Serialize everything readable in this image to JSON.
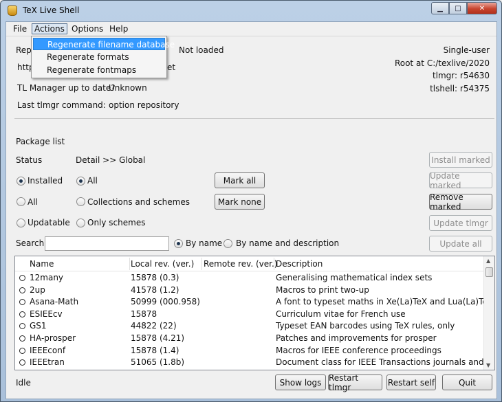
{
  "window": {
    "title": "TeX Live Shell"
  },
  "menu": {
    "file": "File",
    "actions": "Actions",
    "options": "Options",
    "help": "Help"
  },
  "actions_menu": {
    "items": [
      "Regenerate filename database",
      "Regenerate formats",
      "Regenerate fontmaps"
    ]
  },
  "info": {
    "repo_label_fragment": "Rep",
    "repo_status": "Not loaded",
    "url_fragment": "http",
    "url_tail": "et",
    "tlmgr_uptodate_label": "TL Manager up to date?",
    "tlmgr_uptodate_value": "Unknown",
    "last_cmd_label": "Last tlmgr command:",
    "last_cmd_value": "option repository",
    "mode": "Single-user",
    "root": "Root at C:/texlive/2020",
    "tlmgr_rev": "tlmgr: r54630",
    "tlshell_rev": "tlshell: r54375"
  },
  "package_list": {
    "heading": "Package list",
    "status_label": "Status",
    "detail_label": "Detail >> Global",
    "status_options": [
      "Installed",
      "All",
      "Updatable"
    ],
    "status_selected": "Installed",
    "detail_options": [
      "All",
      "Collections and schemes",
      "Only schemes"
    ],
    "detail_selected": "All",
    "mark_all": "Mark all",
    "mark_none": "Mark none",
    "install_marked": "Install marked",
    "update_marked": "Update marked",
    "remove_marked": "Remove marked",
    "update_tlmgr": "Update tlmgr",
    "update_all": "Update all",
    "search_label": "Search",
    "search_value": "",
    "search_modes": [
      "By name",
      "By name and description"
    ],
    "search_mode_selected": "By name"
  },
  "table": {
    "columns": [
      "Name",
      "Local rev. (ver.)",
      "Remote rev. (ver.)",
      "Description"
    ],
    "rows": [
      {
        "name": "12many",
        "local": "15878 (0.3)",
        "remote": "",
        "desc": "Generalising mathematical index sets"
      },
      {
        "name": "2up",
        "local": "41578 (1.2)",
        "remote": "",
        "desc": "Macros to print two-up"
      },
      {
        "name": "Asana-Math",
        "local": "50999 (000.958)",
        "remote": "",
        "desc": "A font to typeset maths in Xe(La)TeX and Lua(La)TeX"
      },
      {
        "name": "ESIEEcv",
        "local": "15878",
        "remote": "",
        "desc": "Curriculum vitae for French use"
      },
      {
        "name": "GS1",
        "local": "44822 (22)",
        "remote": "",
        "desc": "Typeset EAN barcodes using TeX rules, only"
      },
      {
        "name": "HA-prosper",
        "local": "15878 (4.21)",
        "remote": "",
        "desc": "Patches and improvements for prosper"
      },
      {
        "name": "IEEEconf",
        "local": "15878 (1.4)",
        "remote": "",
        "desc": "Macros for IEEE conference proceedings"
      },
      {
        "name": "IEEEtran",
        "local": "51065 (1.8b)",
        "remote": "",
        "desc": "Document class for IEEE Transactions journals and conf"
      }
    ]
  },
  "footer": {
    "status": "Idle",
    "show_logs": "Show logs",
    "restart_tlmgr": "Restart tlmgr",
    "restart_self": "Restart self",
    "quit": "Quit"
  }
}
